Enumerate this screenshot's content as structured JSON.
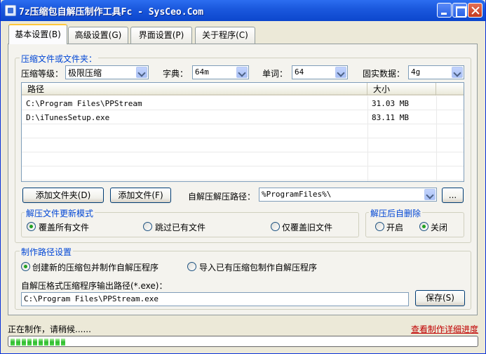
{
  "window": {
    "title": "7z压缩包自解压制作工具Fc - SysCeo.Com"
  },
  "tabs": [
    {
      "label": "基本设置(B)",
      "active": true
    },
    {
      "label": "高级设置(G)",
      "active": false
    },
    {
      "label": "界面设置(P)",
      "active": false
    },
    {
      "label": "关于程序(C)",
      "active": false
    }
  ],
  "compress": {
    "group_label": "压缩文件或文件夹：",
    "level_label": "压缩等级：",
    "level_value": "极限压缩",
    "dict_label": "字典：",
    "dict_value": "64m",
    "word_label": "单词：",
    "word_value": "64",
    "solid_label": "固实数据：",
    "solid_value": "4g"
  },
  "file_list": {
    "columns": [
      "路径",
      "大小"
    ],
    "rows": [
      {
        "path": "C:\\Program Files\\PPStream",
        "size": "31.03 MB"
      },
      {
        "path": "D:\\iTunesSetup.exe",
        "size": "83.11 MB"
      }
    ]
  },
  "actions": {
    "add_folder": "添加文件夹(D)",
    "add_file": "添加文件(F)",
    "extract_path_label": "自解压解压路径：",
    "extract_path_value": "%ProgramFiles%\\",
    "browse": "..."
  },
  "update_mode": {
    "group_label": "解压文件更新模式",
    "options": [
      {
        "label": "覆盖所有文件",
        "checked": true
      },
      {
        "label": "跳过已有文件",
        "checked": false
      },
      {
        "label": "仅覆盖旧文件",
        "checked": false
      }
    ]
  },
  "delete_after": {
    "group_label": "解压后自删除",
    "options": [
      {
        "label": "开启",
        "checked": false
      },
      {
        "label": "关闭",
        "checked": true
      }
    ]
  },
  "make_path": {
    "group_label": "制作路径设置",
    "options": [
      {
        "label": "创建新的压缩包并制作自解压程序",
        "checked": true
      },
      {
        "label": "导入已有压缩包制作自解压程序",
        "checked": false
      }
    ],
    "output_label": "自解压格式压缩程序输出路径(*.exe)：",
    "output_value": "C:\\Program Files\\PPStream.exe",
    "save": "保存(S)"
  },
  "status": {
    "text": "正在制作，请稍候......",
    "link": "查看制作详细进度",
    "progress": 0.12
  },
  "colors": {
    "accent_label": "#0046d5",
    "link": "#c00000",
    "progress": "#2fbb2f"
  }
}
